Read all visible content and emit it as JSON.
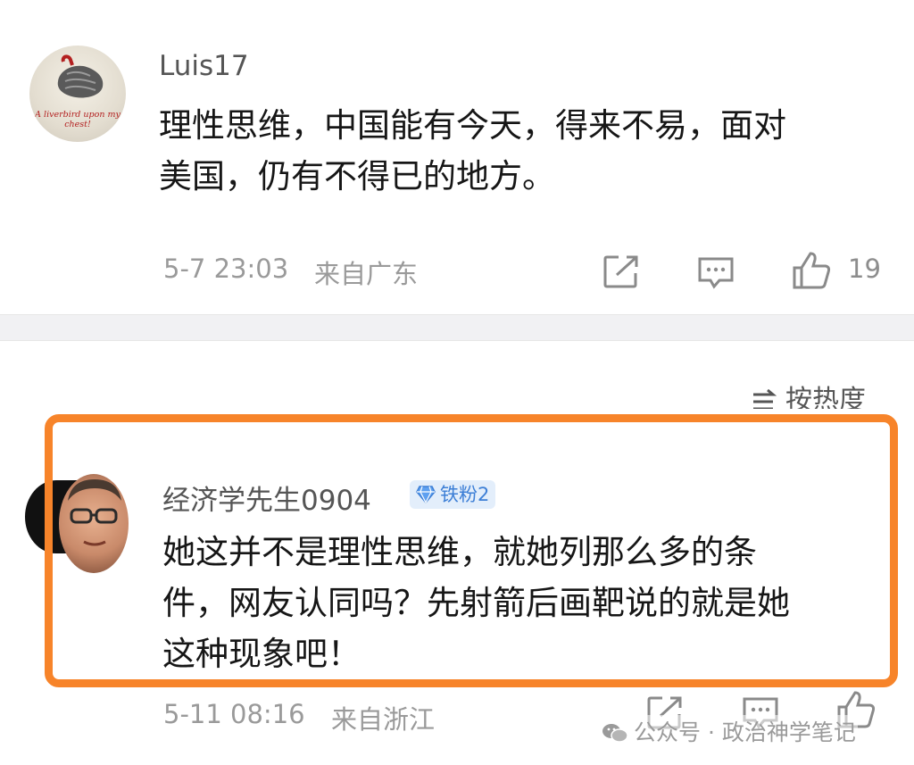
{
  "comments": [
    {
      "username": "Luis17",
      "avatar_text": "A liverbird upon my chest!",
      "text_lines": [
        "理性思维，中国能有今天，得来不易，面对",
        "美国，仍有不得已的地方。"
      ],
      "timestamp": "5-7 23:03",
      "location": "来自广东",
      "like_count": "19"
    },
    {
      "username": "经济学先生0904",
      "badge": "铁粉2",
      "text_lines": [
        "她这并不是理性思维，就她列那么多的条",
        "件，网友认同吗？先射箭后画靶说的就是她",
        "这种现象吧！"
      ],
      "timestamp": "5-11 08:16",
      "location": "来自浙江"
    }
  ],
  "sort_label": "按热度",
  "watermark": "公众号 · 政治神学笔记",
  "icons": [
    "forward-icon",
    "comment-icon",
    "like-icon",
    "sort-icon",
    "diamond-badge-icon",
    "wechat-icon"
  ],
  "colors": {
    "highlight": "#f7842a",
    "badge_text": "#3d7fd6",
    "badge_bg": "#e3eefb",
    "meta": "#9a9a9a"
  }
}
